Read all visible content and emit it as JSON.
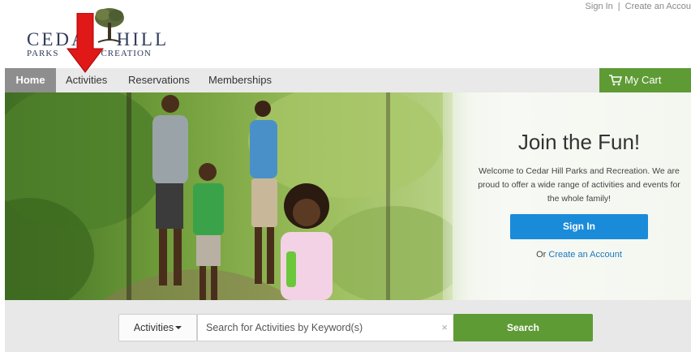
{
  "header": {
    "sign_in_link": "Sign In",
    "separator": "|",
    "create_account_link": "Create an Accou"
  },
  "logo": {
    "brand_left": "CEDA",
    "brand_right": "HILL",
    "tagline_left": "PARKS",
    "tagline_right": "CREATION"
  },
  "nav": {
    "items": [
      {
        "label": "Home",
        "active": true
      },
      {
        "label": "Activities"
      },
      {
        "label": "Reservations"
      },
      {
        "label": "Memberships"
      }
    ],
    "cart_label": "My Cart",
    "cart_icon": "shopping-cart-icon"
  },
  "hero": {
    "title": "Join the Fun!",
    "description": "Welcome to Cedar Hill Parks and Recreation. We are proud to offer a wide range of activities and events for the whole family!",
    "sign_in_button": "Sign In",
    "create_prefix": "Or",
    "create_link": "Create an Account"
  },
  "search": {
    "category": "Activities",
    "placeholder": "Search for Activities by Keyword(s)",
    "clear_symbol": "×",
    "button_label": "Search"
  },
  "colors": {
    "nav_active": "#8e8e8e",
    "cart_green": "#5e9b35",
    "signin_blue": "#1a8bd8",
    "annotation_arrow": "#e01818"
  }
}
